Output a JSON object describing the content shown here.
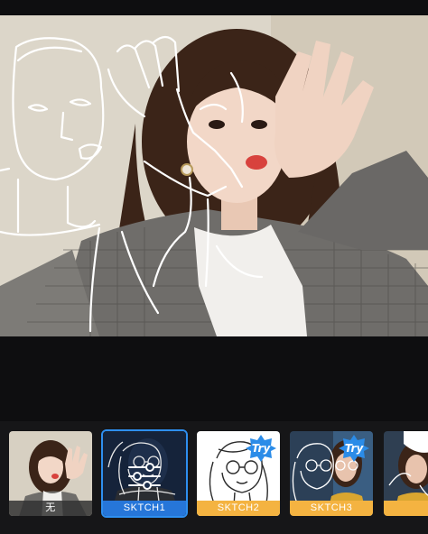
{
  "filters": [
    {
      "label": "无",
      "selected": false,
      "try": false
    },
    {
      "label": "SKTCH1",
      "selected": true,
      "try": false
    },
    {
      "label": "SKTCH2",
      "selected": false,
      "try": true
    },
    {
      "label": "SKTCH3",
      "selected": false,
      "try": true
    },
    {
      "label": "",
      "selected": false,
      "try": false
    }
  ],
  "try_badge": "Try",
  "icons": {
    "settings": "sliders-icon",
    "try": "try-star-badge"
  },
  "colors": {
    "selected_border": "#2e8ff0",
    "label_selected_bg": "#2676d9",
    "label_gold_bg": "#f4b341",
    "try_badge": "#2b8ce8",
    "background": "#0e0e10"
  }
}
